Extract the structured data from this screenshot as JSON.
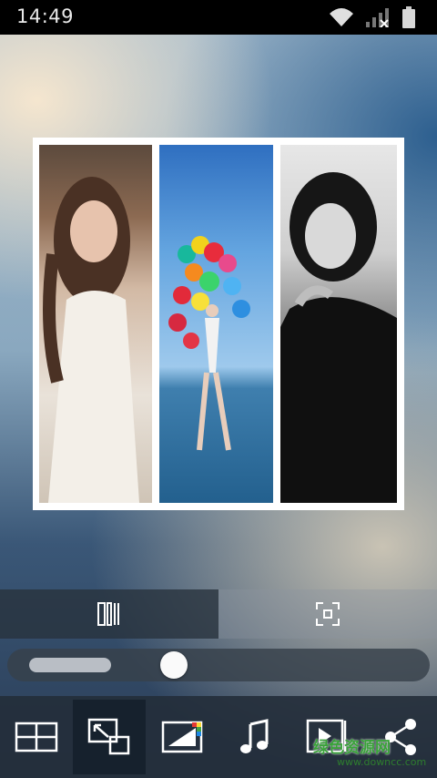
{
  "status_bar": {
    "time": "14:49",
    "icons": [
      "wifi-icon",
      "signal-icon",
      "battery-icon"
    ]
  },
  "collage": {
    "layout": "3 vertical panels",
    "panels": [
      "photo-portrait-woman",
      "photo-woman-balloons-sea",
      "photo-bw-portrait"
    ]
  },
  "mode_tabs": {
    "active": "columns-icon",
    "items": [
      "columns-icon",
      "expand-frame-icon"
    ]
  },
  "slider": {
    "level": 0.2
  },
  "toolbar": {
    "selected_index": 1,
    "items": [
      "grid-layout-icon",
      "resize-icon",
      "frame-color-icon",
      "music-icon",
      "video-preview-icon",
      "share-icon"
    ]
  },
  "watermark": {
    "main": "绿色资源网",
    "sub": "www.downcc.com"
  },
  "colors": {
    "status_bar_bg": "#000000",
    "toolbar_bg": "#232d3a",
    "collage_border": "#ffffff",
    "watermark": "#3aa23a"
  }
}
